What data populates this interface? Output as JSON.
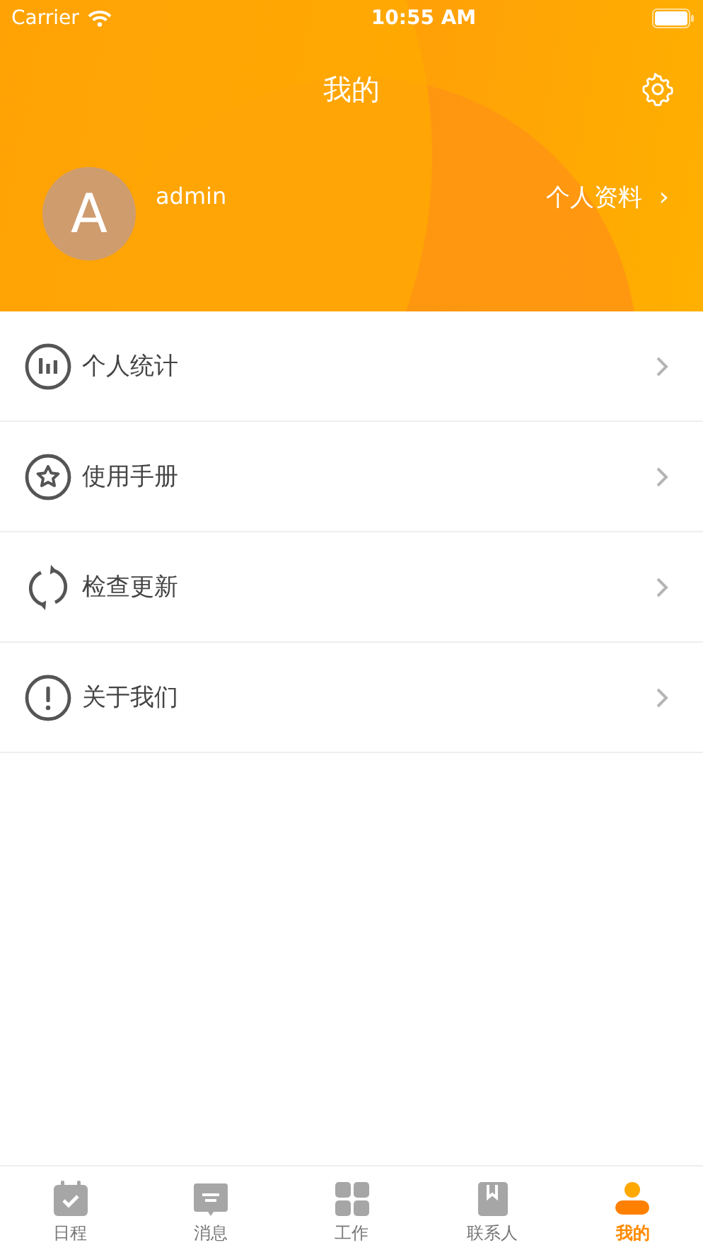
{
  "status_bar": {
    "carrier": "Carrier",
    "time": "10:55 AM"
  },
  "header": {
    "title": "我的"
  },
  "profile": {
    "avatar_letter": "A",
    "username": "admin",
    "link": "个人资料",
    "link_arrow": "›"
  },
  "menu": [
    {
      "kind": "stats",
      "label": "个人统计"
    },
    {
      "kind": "star",
      "label": "使用手册"
    },
    {
      "kind": "refresh",
      "label": "检查更新"
    },
    {
      "kind": "info",
      "label": "关于我们"
    }
  ],
  "tab_bar": [
    {
      "kind": "calendar",
      "label": "日程",
      "selected": false
    },
    {
      "kind": "message",
      "label": "消息",
      "selected": false
    },
    {
      "kind": "grid",
      "label": "工作",
      "selected": false
    },
    {
      "kind": "contacts",
      "label": "联系人",
      "selected": false
    },
    {
      "kind": "person",
      "label": "我的",
      "selected": true
    }
  ]
}
